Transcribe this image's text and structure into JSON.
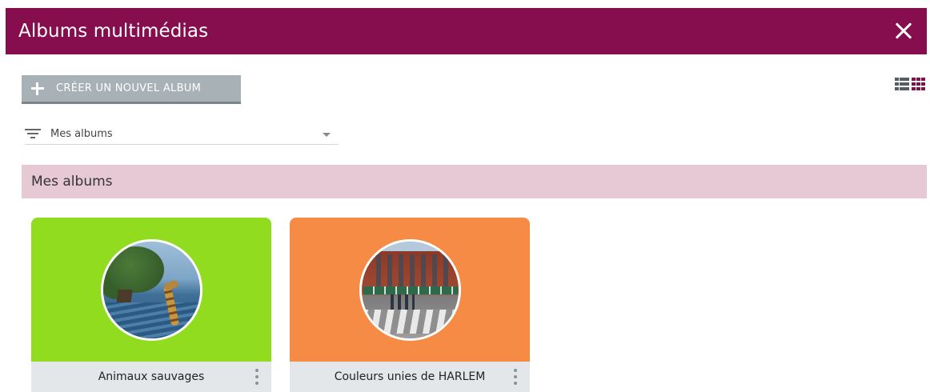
{
  "window": {
    "title": "Albums multimédias",
    "close_icon": "close-icon"
  },
  "toolbar": {
    "create_label": "CRÉER UN NOUVEL ALBUM",
    "create_icon": "plus-icon",
    "list_view_icon": "list-view-icon",
    "grid_view_icon": "grid-view-icon",
    "active_view": "grid"
  },
  "filter": {
    "icon": "filter-icon",
    "selected": "Mes albums"
  },
  "section": {
    "title": "Mes albums"
  },
  "albums": [
    {
      "title": "Animaux sauvages",
      "cover_color": "#91dc1e"
    },
    {
      "title": "Couleurs unies de HARLEM",
      "cover_color": "#f58b45"
    }
  ],
  "colors": {
    "brand": "#860d4e",
    "section_bg": "#e7c9d5",
    "button_bg": "#a7b1b6",
    "card_footer_bg": "#e4e7e9"
  }
}
